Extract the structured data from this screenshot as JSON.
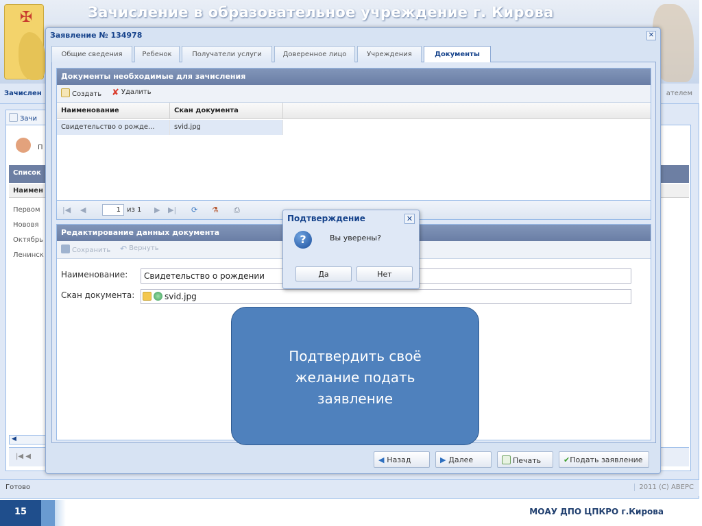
{
  "app": {
    "banner_title": "Зачисление в образовательное учреждение г. Кирова",
    "subbar_left": "Зачислен",
    "subbar_right": "ателем",
    "bg_tab": "Зачи",
    "bg_tool_label": "П",
    "bg_grid_header": "Список",
    "bg_col_header": "Наимен",
    "bg_rows": [
      "Первом",
      "Нововя",
      "Октябрь",
      "Ленинск"
    ],
    "status_left": "Готово",
    "status_right": "2011 (С) АВЕРС"
  },
  "window": {
    "title": "Заявление № 134978",
    "close_glyph": "✕",
    "tabs": [
      {
        "label": "Общие сведения"
      },
      {
        "label": "Ребенок"
      },
      {
        "label": "Получатели услуги"
      },
      {
        "label": "Доверенное лицо"
      },
      {
        "label": "Учреждения"
      },
      {
        "label": "Документы"
      }
    ]
  },
  "docs_panel": {
    "title": "Документы необходимые для зачисления",
    "create_label": "Создать",
    "delete_label": "Удалить",
    "columns": [
      "Наименование",
      "Скан документа"
    ],
    "rows": [
      {
        "name": "Свидетельство о рожде...",
        "scan": "svid.jpg"
      }
    ],
    "pager": {
      "page": "1",
      "of_label": "из 1"
    }
  },
  "edit_panel": {
    "title": "Редактирование данных документа",
    "save_label": "Сохранить",
    "revert_label": "Вернуть",
    "name_label": "Наименование:",
    "name_value": "Свидетельство о рождении",
    "scan_label": "Скан документа:",
    "scan_value": "svid.jpg"
  },
  "callout": {
    "lines": [
      "Подтвердить своё",
      "желание подать",
      "заявление"
    ]
  },
  "bottom_buttons": {
    "back": "Назад",
    "next": "Далее",
    "print": "Печать",
    "submit": "Подать заявление"
  },
  "dialog": {
    "title": "Подтверждение",
    "message": "Вы уверены?",
    "yes": "Да",
    "no": "Нет",
    "icon_glyph": "?",
    "close_glyph": "✕"
  },
  "footer": {
    "slide_number": "15",
    "organization": "МОАУ ДПО ЦПКРО г.Кирова"
  },
  "colors": {
    "accent": "#15428b",
    "panel_header": "#6a7ea5",
    "callout": "#4f81bd",
    "footer_blue": "#1f4e8c"
  },
  "icons": {
    "create": "document-add-icon",
    "delete": "delete-x-icon",
    "save": "floppy-disk-icon",
    "revert": "undo-icon",
    "upload": "folder-upload-icon",
    "view": "view-icon",
    "back": "arrow-left-icon",
    "next": "arrow-right-icon",
    "print": "print-icon",
    "submit": "checkmark-icon",
    "question": "question-icon"
  }
}
